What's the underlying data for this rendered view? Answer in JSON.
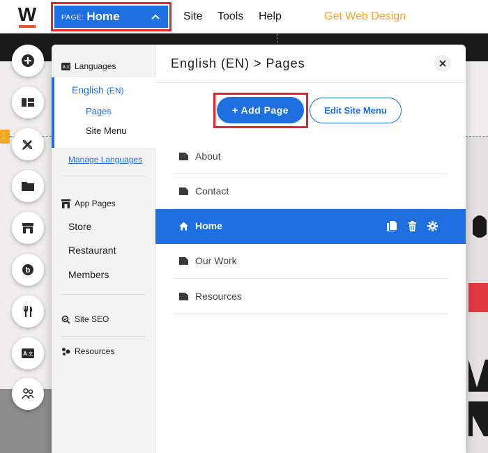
{
  "topbar": {
    "logo_letter": "W",
    "page_prefix": "PAGE:",
    "page_name": "Home",
    "menu": {
      "site": "Site",
      "tools": "Tools",
      "help": "Help",
      "cta": "Get Web Design"
    }
  },
  "colors": {
    "accent": "#1e6fe0",
    "highlight_frame": "#e0262f",
    "cta": "#f5a623",
    "logo_bar": "#e8562a"
  },
  "rail": {
    "icons": [
      "plus-circle-icon",
      "layout-icon",
      "design-tools-icon",
      "folder-icon",
      "app-store-icon",
      "blog-icon",
      "restaurant-icon",
      "translate-icon",
      "members-icon"
    ]
  },
  "sidebar": {
    "languages_header": "Languages",
    "language": {
      "name": "English",
      "code": "(EN)"
    },
    "sub_pages": "Pages",
    "sub_site_menu": "Site Menu",
    "manage_languages": "Manage Languages",
    "app_pages_header": "App Pages",
    "app_pages": [
      "Store",
      "Restaurant",
      "Members"
    ],
    "site_seo": "Site SEO",
    "resources": "Resources"
  },
  "content": {
    "title": "English (EN) > Pages",
    "add_page": "+ Add Page",
    "edit_site_menu": "Edit Site Menu",
    "pages": [
      {
        "label": "About",
        "active": false
      },
      {
        "label": "Contact",
        "active": false
      },
      {
        "label": "Home",
        "active": true
      },
      {
        "label": "Our Work",
        "active": false
      },
      {
        "label": "Resources",
        "active": false
      }
    ]
  }
}
